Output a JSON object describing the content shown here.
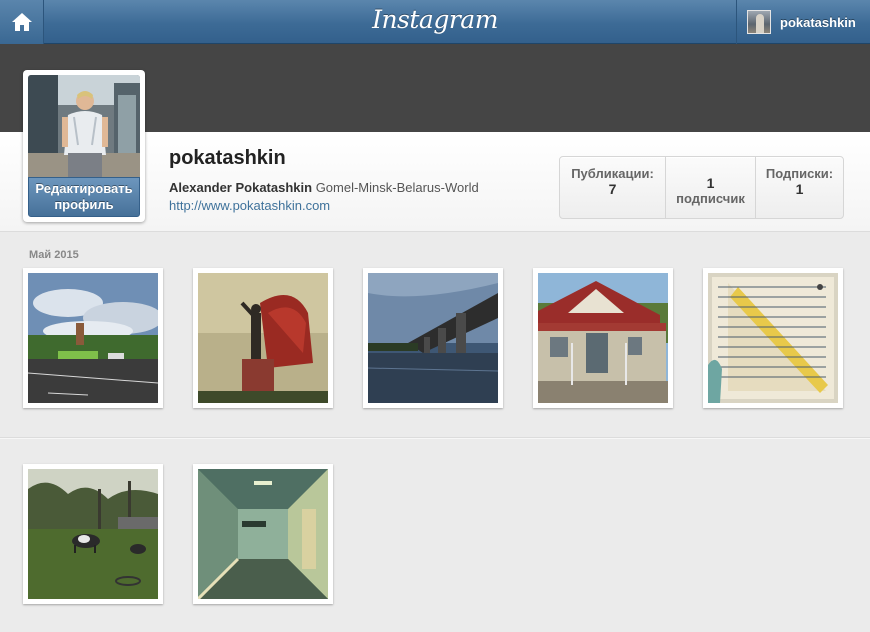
{
  "header": {
    "home_icon": "home-icon",
    "logo": "Instagram",
    "user": "pokatashkin"
  },
  "profile": {
    "username": "pokatashkin",
    "full_name": "Alexander Pokatashkin",
    "bio": "Gomel-Minsk-Belarus-World",
    "website": "http://www.pokatashkin.com",
    "edit_line1": "Редактировать",
    "edit_line2": "профиль"
  },
  "stats": {
    "posts_label": "Публикации:",
    "posts_value": "7",
    "followers_value": "1",
    "followers_label": "подписчик",
    "following_label": "Подписки:",
    "following_value": "1"
  },
  "feed": {
    "month": "Май 2015"
  },
  "colors": {
    "header": "#3d6b96",
    "link": "#3f729b",
    "cover": "#454545"
  }
}
